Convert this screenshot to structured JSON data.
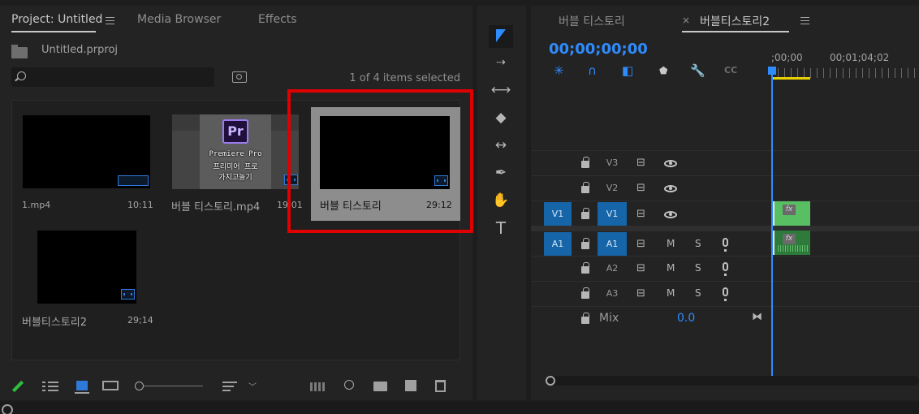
{
  "project_panel": {
    "tabs": [
      {
        "label": "Project: Untitled",
        "active": true
      },
      {
        "label": "Media Browser",
        "active": false
      },
      {
        "label": "Effects",
        "active": false
      }
    ],
    "filename": "Untitled.prproj",
    "search_placeholder": "",
    "selection_status": "1 of 4 items selected",
    "clips": [
      {
        "name": "1.mp4",
        "duration": "10:11",
        "selected": false
      },
      {
        "name": "버블 티스토리.mp4",
        "duration": "19:01",
        "selected": false
      },
      {
        "name": "버블 티스토리",
        "duration": "29:12",
        "selected": true
      },
      {
        "name": "버블티스토리2",
        "duration": "29;14",
        "selected": false
      }
    ],
    "thumbnail_overlay": {
      "logo": "Pr",
      "lines": [
        "Premiere Pro",
        "프리미어 프로",
        "가지고놀기"
      ]
    },
    "highlight_color": "#e00000"
  },
  "tools": [
    {
      "name": "selection-tool",
      "active": true
    },
    {
      "name": "track-select-forward-tool"
    },
    {
      "name": "ripple-edit-tool"
    },
    {
      "name": "razor-tool"
    },
    {
      "name": "slip-tool"
    },
    {
      "name": "pen-tool"
    },
    {
      "name": "hand-tool"
    },
    {
      "name": "type-tool",
      "glyph": "T"
    }
  ],
  "timeline_panel": {
    "tabs": [
      {
        "label": "버블 티스토리",
        "active": false,
        "closable": false
      },
      {
        "label": "버블티스토리2",
        "active": true,
        "closable": true
      }
    ],
    "close_glyph": "×",
    "timecode": "00;00;00;00",
    "ruler": [
      ";00;00",
      "00;01;04;02"
    ],
    "video_tracks": [
      {
        "name": "V3",
        "targeted": false,
        "source": ""
      },
      {
        "name": "V2",
        "targeted": false,
        "source": ""
      },
      {
        "name": "V1",
        "targeted": true,
        "source": "V1"
      }
    ],
    "audio_tracks": [
      {
        "name": "A1",
        "targeted": true,
        "source": "A1"
      },
      {
        "name": "A2",
        "targeted": false,
        "source": ""
      },
      {
        "name": "A3",
        "targeted": false,
        "source": ""
      }
    ],
    "mute_label": "M",
    "solo_label": "S",
    "fx_label": "fx",
    "mix_label": "Mix",
    "mix_value": "0.0",
    "accent_color": "#2f8cff"
  }
}
